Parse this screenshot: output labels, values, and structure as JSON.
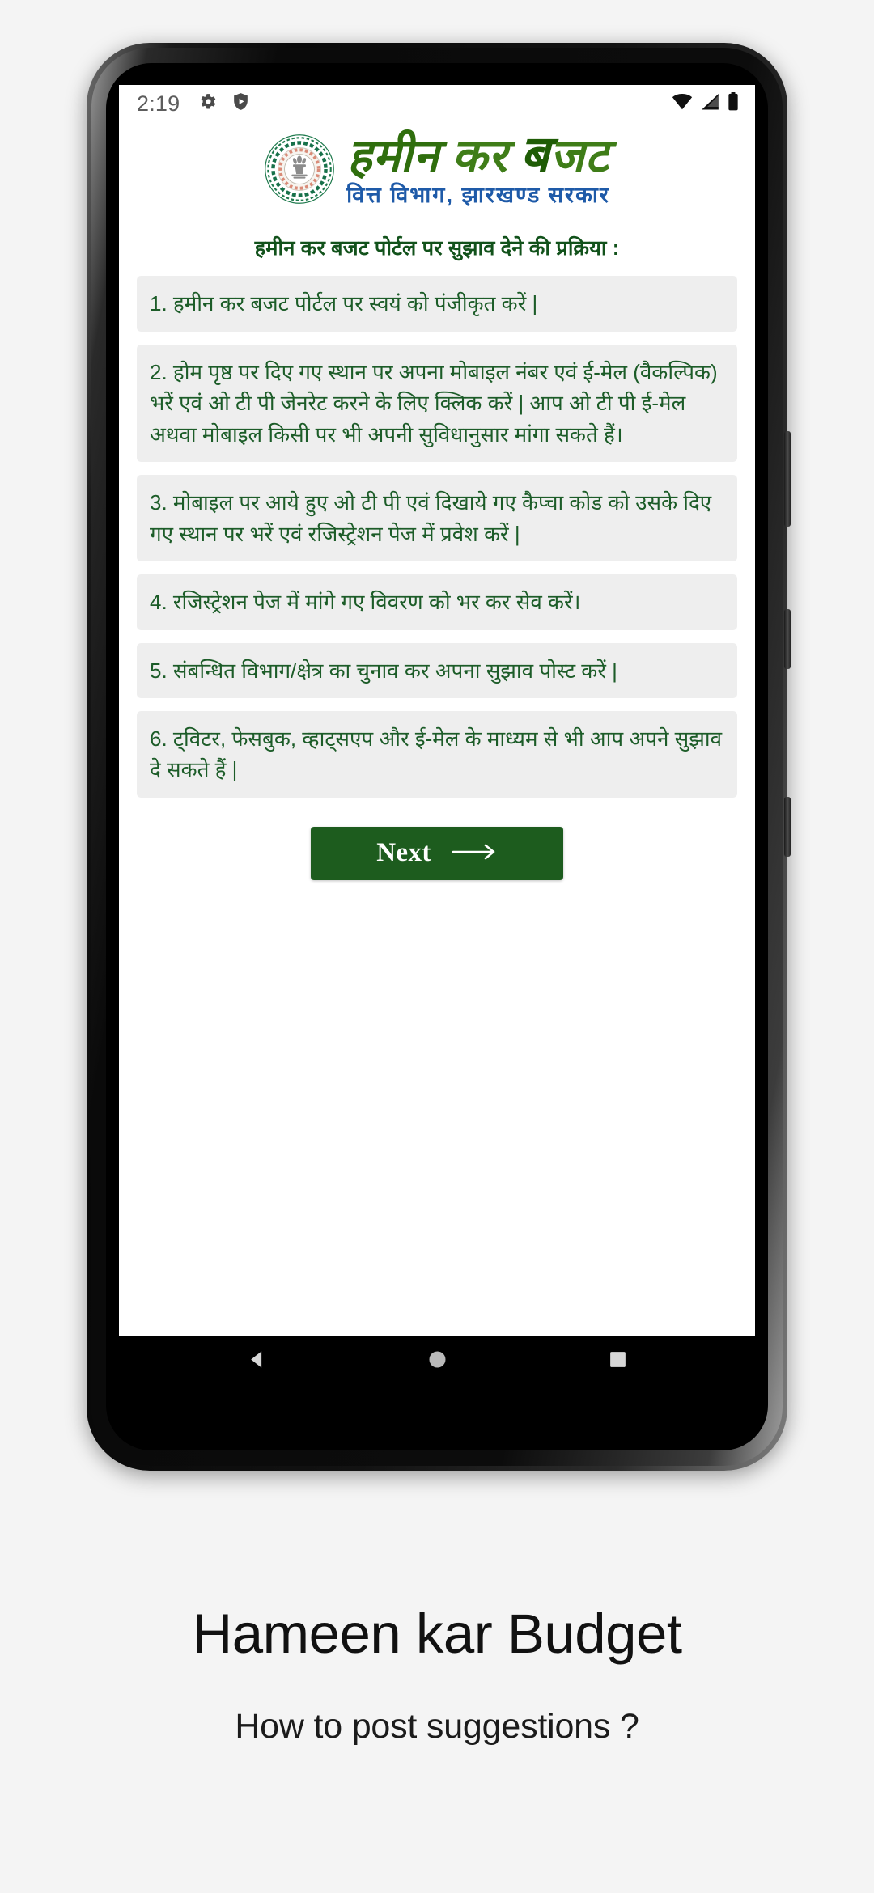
{
  "statusbar": {
    "time": "2:19",
    "left_icons": [
      "gear-icon",
      "shield-play-icon"
    ],
    "right_icons": [
      "wifi-icon",
      "signal-icon",
      "battery-icon"
    ]
  },
  "app_header": {
    "emblem_alt": "jharkhand-government-emblem",
    "logo_hi_1": "हमीन",
    "logo_hi_2": "कर",
    "logo_hi_3": "ब",
    "logo_hi_4": "जट",
    "logo_subtitle": "वित्त विभाग,  झारखण्ड  सरकार",
    "logo_color_green": "#3f7d18",
    "logo_color_blue": "#1e5aa8"
  },
  "content": {
    "page_title": "हमीन कर बजट पोर्टल पर सुझाव देने की प्रक्रिया :",
    "steps": [
      "1. हमीन कर बजट पोर्टल पर स्वयं को पंजीकृत करें |",
      "2. होम पृष्ठ पर दिए गए स्थान पर अपना मोबाइल नंबर एवं ई-मेल (वैकल्पिक) भरें एवं ओ टी पी जेनरेट करने के लिए क्लिक करें | आप ओ टी पी ई-मेल अथवा मोबाइल किसी पर भी अपनी सुविधानुसार मांगा सकते हैं।",
      "3. मोबाइल पर आये हुए ओ टी पी एवं दिखाये गए कैप्चा कोड को उसके दिए गए स्थान पर भरें एवं रजिस्ट्रेशन पेज में प्रवेश करें |",
      "4. रजिस्ट्रेशन पेज में मांगे गए विवरण को भर कर सेव करें।",
      "5. संबन्धित विभाग/क्षेत्र का चुनाव कर अपना सुझाव पोस्ट करें |",
      "6. ट्विटर, फेसबुक, व्हाट्सएप और ई-मेल के माध्यम से भी आप अपने सुझाव दे सकते हैं |"
    ],
    "next_button": "Next",
    "next_button_color": "#1d5c1e",
    "step_background": "#eeeeee",
    "step_text_color": "#1c5c28"
  },
  "navbar": {
    "back": "back-triangle-icon",
    "home": "home-circle-icon",
    "recents": "recents-square-icon"
  },
  "captions": {
    "title": "Hameen kar Budget",
    "subtitle": "How to post suggestions ?"
  }
}
